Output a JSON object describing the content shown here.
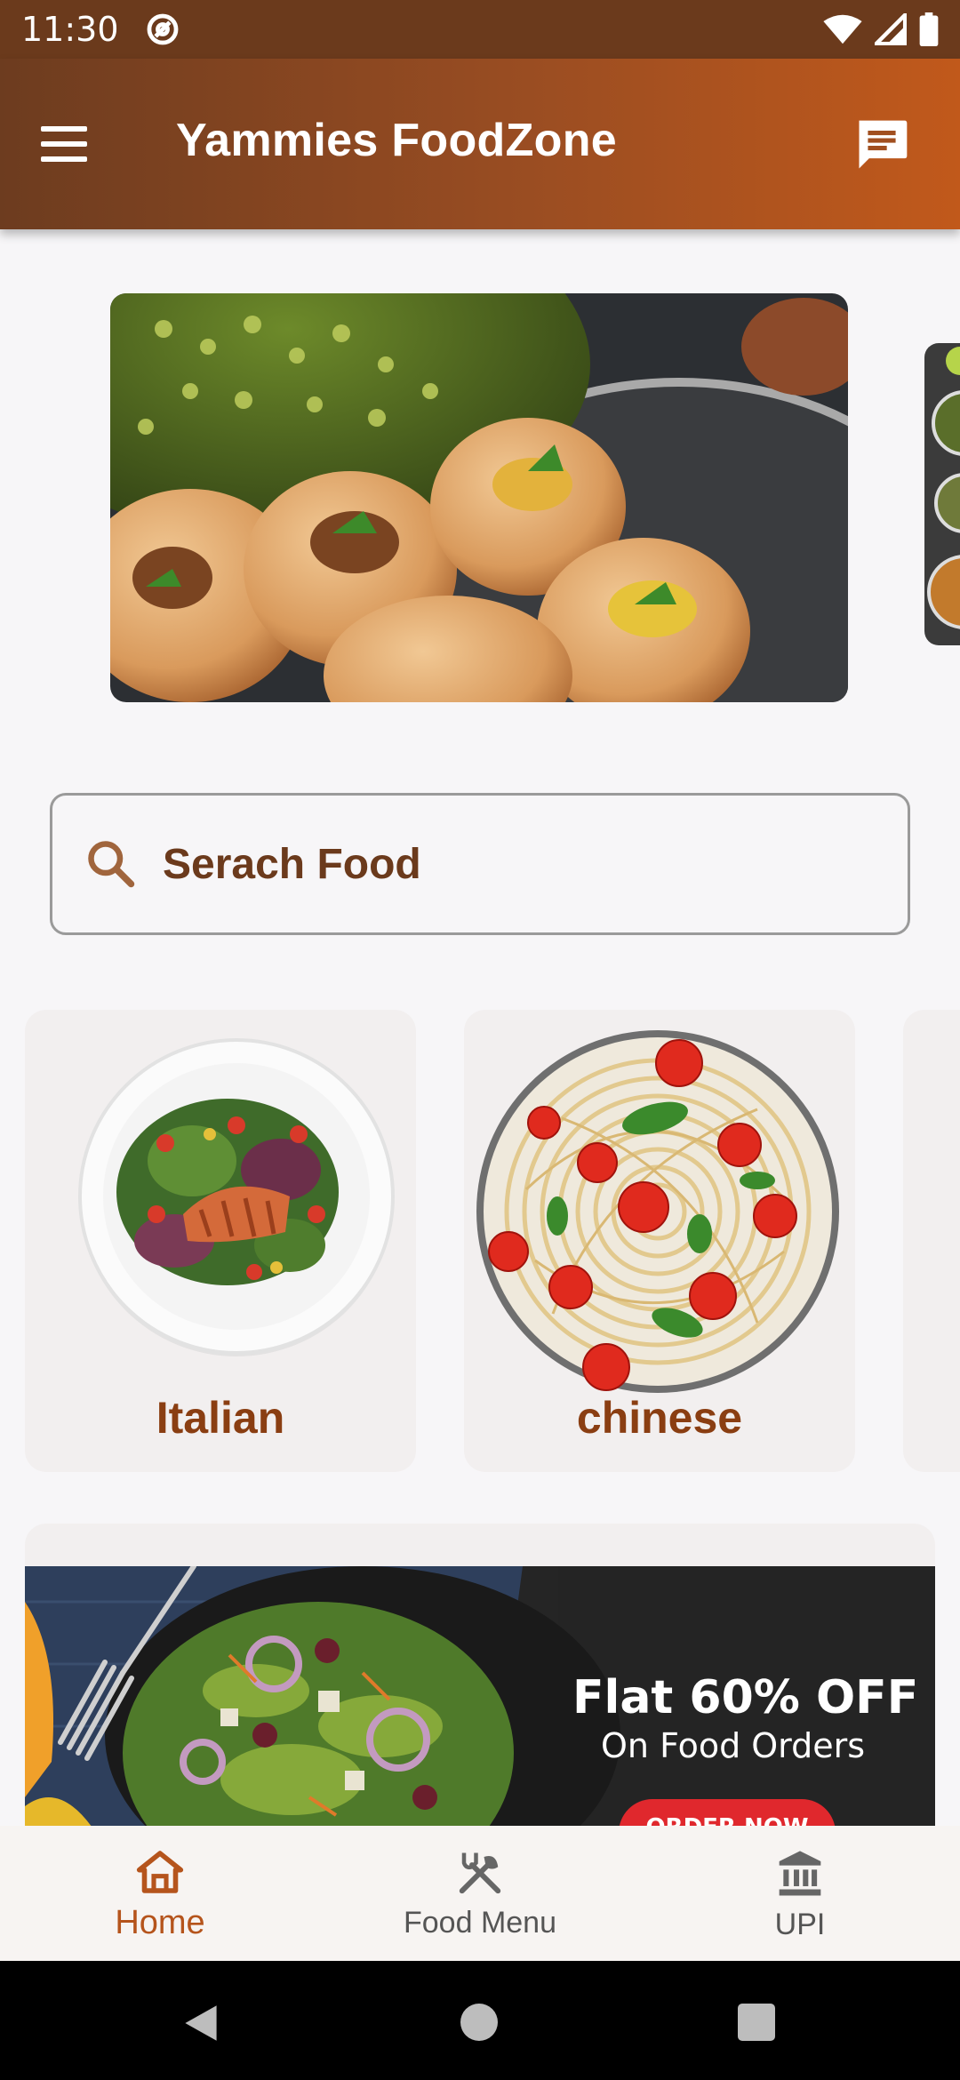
{
  "status_bar": {
    "time": "11:30"
  },
  "app_bar": {
    "title": "Yammies FoodZone"
  },
  "search": {
    "placeholder": "Serach Food"
  },
  "categories": [
    {
      "label": "Italian"
    },
    {
      "label": "chinese"
    }
  ],
  "promo": {
    "title": "Flat 60% OFF",
    "subtitle": "On Food Orders",
    "button": "ORDER NOW"
  },
  "bottom_nav": [
    {
      "label": "Home",
      "active": true
    },
    {
      "label": "Food Menu",
      "active": false
    },
    {
      "label": "UPI",
      "active": false
    }
  ],
  "colors": {
    "accent": "#b5541c",
    "app_bar_start": "#6d3c1f",
    "app_bar_end": "#c1591b",
    "category_text": "#8a3e12"
  }
}
